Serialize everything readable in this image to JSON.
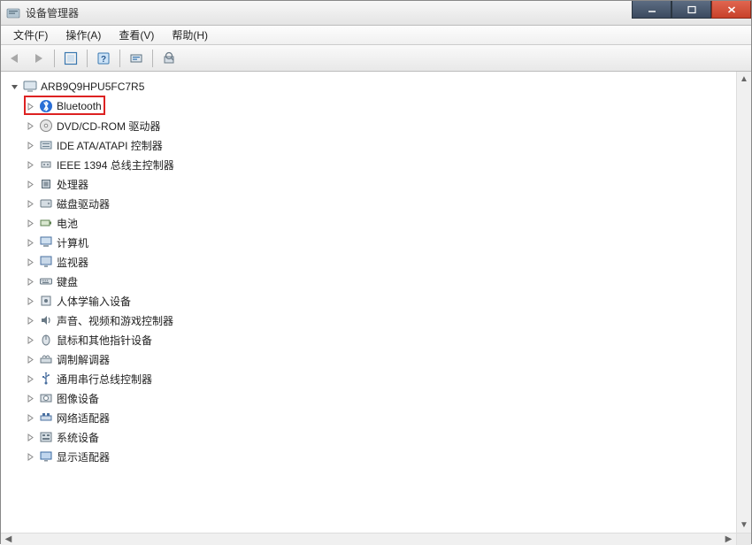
{
  "window": {
    "title": "设备管理器"
  },
  "menu": {
    "file": "文件(F)",
    "action": "操作(A)",
    "view": "查看(V)",
    "help": "帮助(H)"
  },
  "tree": {
    "root": "ARB9Q9HPU5FC7R5",
    "items": [
      {
        "label": "Bluetooth",
        "icon": "bluetooth"
      },
      {
        "label": "DVD/CD-ROM 驱动器",
        "icon": "disc"
      },
      {
        "label": "IDE ATA/ATAPI 控制器",
        "icon": "ide"
      },
      {
        "label": "IEEE 1394 总线主控制器",
        "icon": "ieee1394"
      },
      {
        "label": "处理器",
        "icon": "cpu"
      },
      {
        "label": "磁盘驱动器",
        "icon": "disk"
      },
      {
        "label": "电池",
        "icon": "battery"
      },
      {
        "label": "计算机",
        "icon": "computer"
      },
      {
        "label": "监视器",
        "icon": "monitor"
      },
      {
        "label": "键盘",
        "icon": "keyboard"
      },
      {
        "label": "人体学输入设备",
        "icon": "hid"
      },
      {
        "label": "声音、视频和游戏控制器",
        "icon": "sound"
      },
      {
        "label": "鼠标和其他指针设备",
        "icon": "mouse"
      },
      {
        "label": "调制解调器",
        "icon": "modem"
      },
      {
        "label": "通用串行总线控制器",
        "icon": "usb"
      },
      {
        "label": "图像设备",
        "icon": "imaging"
      },
      {
        "label": "网络适配器",
        "icon": "network"
      },
      {
        "label": "系统设备",
        "icon": "system"
      },
      {
        "label": "显示适配器",
        "icon": "display"
      }
    ]
  },
  "highlighted_index": 0
}
